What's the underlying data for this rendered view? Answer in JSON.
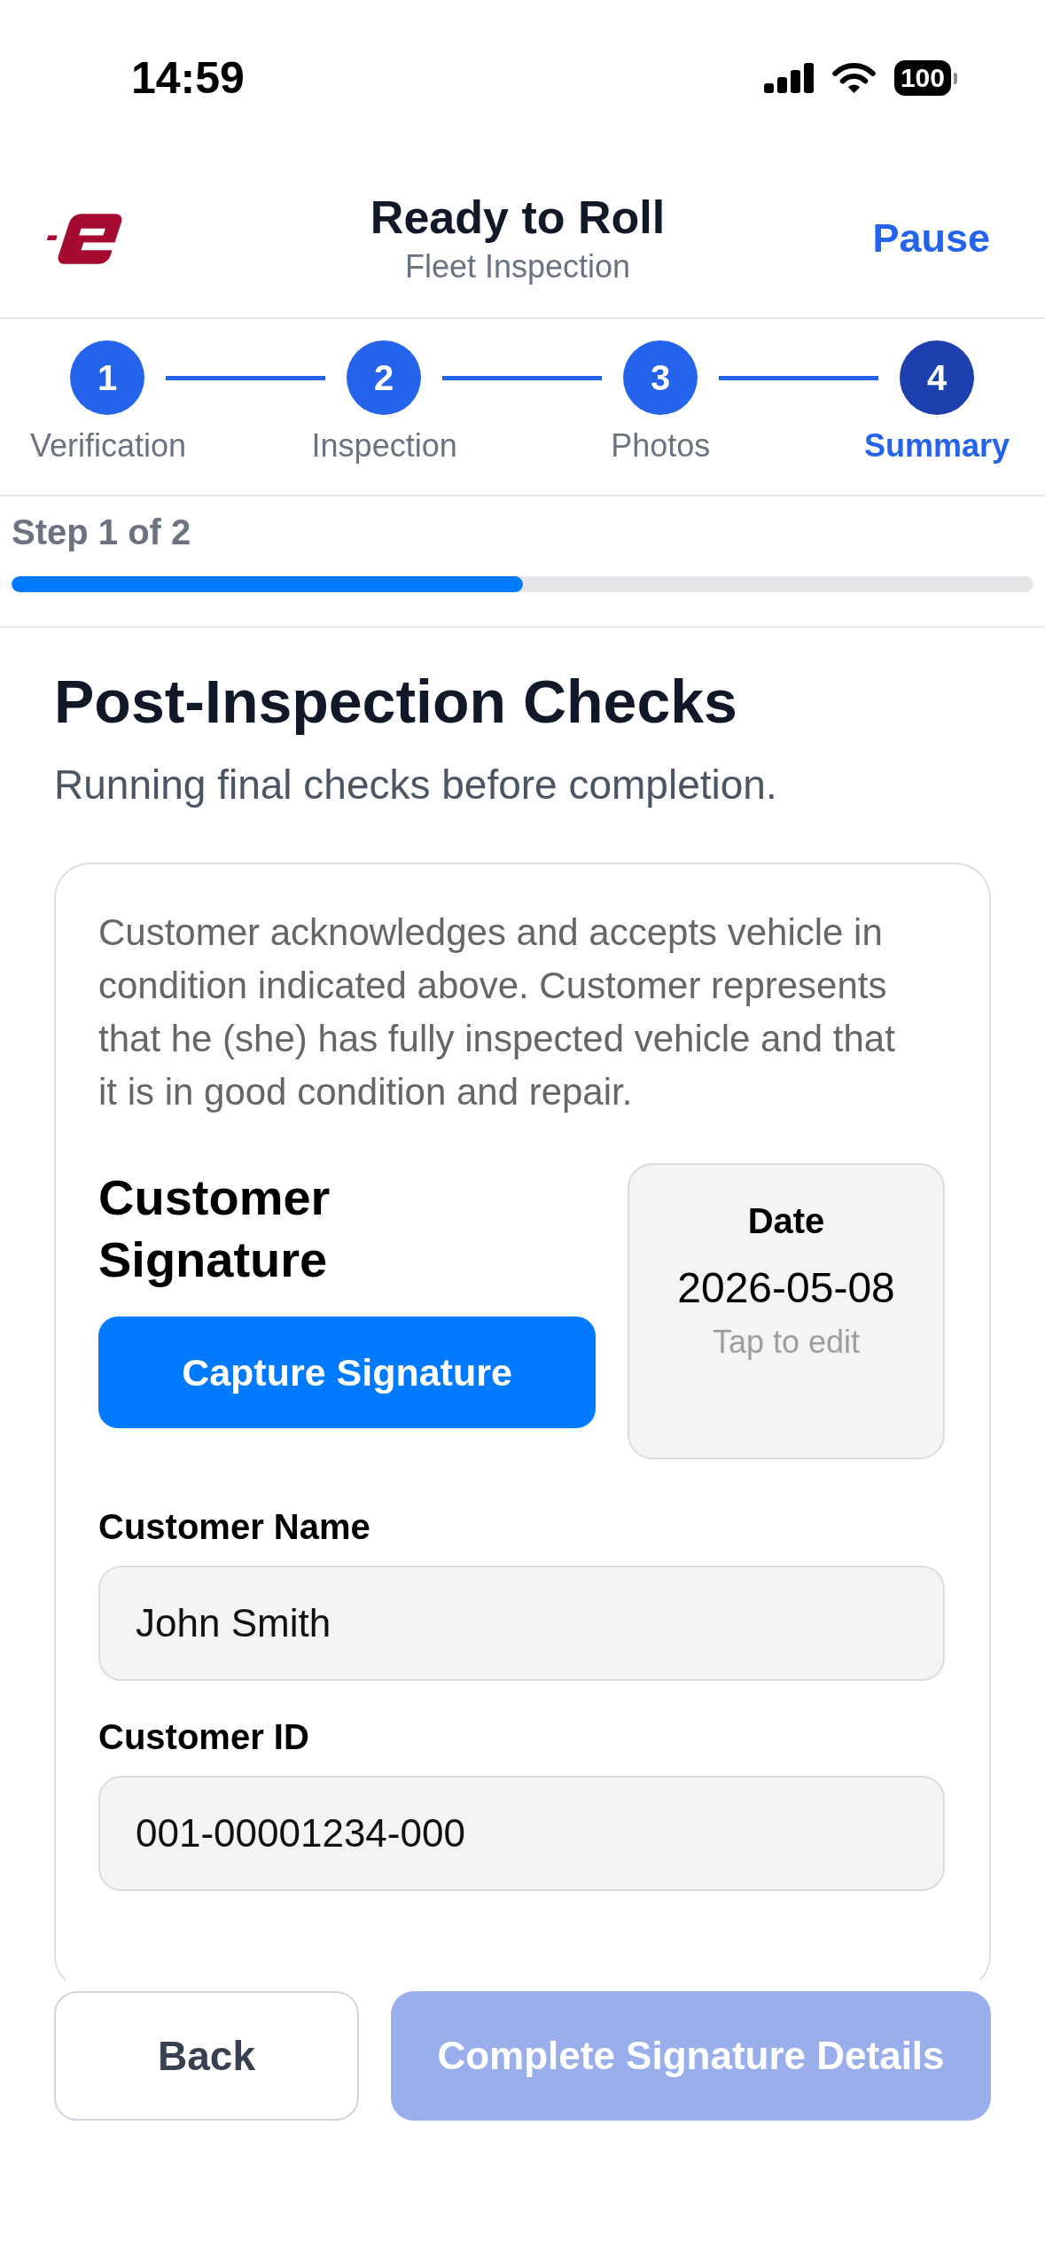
{
  "status_bar": {
    "time": "14:59",
    "battery": "100"
  },
  "header": {
    "title": "Ready to Roll",
    "subtitle": "Fleet Inspection",
    "action": "Pause"
  },
  "steps": [
    {
      "number": "1",
      "label": "Verification",
      "selected": false
    },
    {
      "number": "2",
      "label": "Inspection",
      "selected": false
    },
    {
      "number": "3",
      "label": "Photos",
      "selected": false
    },
    {
      "number": "4",
      "label": "Summary",
      "selected": true
    }
  ],
  "progress": {
    "label": "Step 1 of 2",
    "level": 0.5
  },
  "page": {
    "title": "Post-Inspection Checks",
    "subtitle": "Running final checks before completion."
  },
  "card": {
    "disclaimer": "Customer acknowledges and accepts vehicle in condition indicated above. Customer represents that he (she) has fully inspected vehicle and that it is in good condition and repair.",
    "signature": {
      "heading": "Customer Signature",
      "button": "Capture Signature"
    },
    "date": {
      "label": "Date",
      "value": "2026-05-08",
      "hint": "Tap to edit"
    },
    "fields": [
      {
        "label": "Customer Name",
        "value": "John Smith"
      },
      {
        "label": "Customer ID",
        "value": "001-00001234-000"
      }
    ]
  },
  "footer": {
    "back": "Back",
    "submit": {
      "label": "Complete Signature Details",
      "disabled": true
    }
  }
}
